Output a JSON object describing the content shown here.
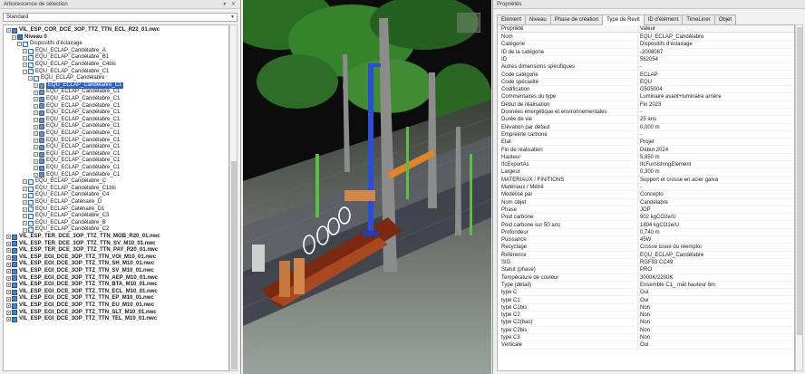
{
  "left_panel": {
    "title": "Arborescence de sélection",
    "controls": "▾ ✕",
    "mode_select": "Standard",
    "tree": [
      {
        "level": 0,
        "expander": "−",
        "icon": "file",
        "label": "VIL_ESP_COR_DCE_3OP_TTZ_TTN_ECL_R22_01.nwc",
        "bold": true
      },
      {
        "level": 1,
        "expander": "−",
        "icon": "layer",
        "label": "Niveau 0",
        "bold": true
      },
      {
        "level": 2,
        "expander": "−",
        "icon": "group",
        "label": "Dispositifs d'éclairage"
      },
      {
        "level": 3,
        "expander": "+",
        "icon": "group",
        "label": "EQU_ECLAP_Candélabre_A"
      },
      {
        "level": 3,
        "expander": "+",
        "icon": "group",
        "label": "EQU_ECLAP_Candélabre_B1"
      },
      {
        "level": 3,
        "expander": "+",
        "icon": "group",
        "label": "EQU_ECLAP_Candélabre_C4bis"
      },
      {
        "level": 3,
        "expander": "−",
        "icon": "group",
        "label": "EQU_ECLAP_Candélabre_C1"
      },
      {
        "level": 4,
        "expander": "−",
        "icon": "group",
        "label": "EQU_ECLAP_Candélabre"
      },
      {
        "level": 5,
        "expander": "+",
        "icon": "obj",
        "label": "EQU_ECLAP_Candélabre_C1",
        "selected": true
      },
      {
        "level": 5,
        "expander": "+",
        "icon": "obj",
        "label": "EQU_ECLAP_Candélabre_C1"
      },
      {
        "level": 5,
        "expander": "+",
        "icon": "obj",
        "label": "EQU_ECLAP_Candélabre_C1"
      },
      {
        "level": 5,
        "expander": "+",
        "icon": "obj",
        "label": "EQU_ECLAP_Candélabre_C1"
      },
      {
        "level": 5,
        "expander": "+",
        "icon": "obj",
        "label": "EQU_ECLAP_Candélabre_C1"
      },
      {
        "level": 5,
        "expander": "+",
        "icon": "obj",
        "label": "EQU_ECLAP_Candélabre_C1"
      },
      {
        "level": 5,
        "expander": "+",
        "icon": "obj",
        "label": "EQU_ECLAP_Candélabre_C1"
      },
      {
        "level": 5,
        "expander": "+",
        "icon": "obj",
        "label": "EQU_ECLAP_Candélabre_C1"
      },
      {
        "level": 5,
        "expander": "+",
        "icon": "obj",
        "label": "EQU_ECLAP_Candélabre_C1"
      },
      {
        "level": 5,
        "expander": "+",
        "icon": "obj",
        "label": "EQU_ECLAP_Candélabre_C1"
      },
      {
        "level": 5,
        "expander": "+",
        "icon": "obj",
        "label": "EQU_ECLAP_Candélabre_C1"
      },
      {
        "level": 5,
        "expander": "+",
        "icon": "obj",
        "label": "EQU_ECLAP_Candélabre_C1"
      },
      {
        "level": 5,
        "expander": "+",
        "icon": "obj",
        "label": "EQU_ECLAP_Candélabre_C1"
      },
      {
        "level": 5,
        "expander": "+",
        "icon": "obj",
        "label": "EQU_ECLAP_Candélabre_C1"
      },
      {
        "level": 3,
        "expander": "+",
        "icon": "group",
        "label": "EQU_ECLAP_Candélabre_C"
      },
      {
        "level": 3,
        "expander": "+",
        "icon": "group",
        "label": "EQU_ECLAP_Candélabre_C1bis"
      },
      {
        "level": 3,
        "expander": "+",
        "icon": "group",
        "label": "EQU_ECLAP_Candélabre_C4"
      },
      {
        "level": 3,
        "expander": "+",
        "icon": "group",
        "label": "EQU_ECLAP_Caténaire_D"
      },
      {
        "level": 3,
        "expander": "+",
        "icon": "group",
        "label": "EQU_ECLAP_Caténaire_D1"
      },
      {
        "level": 3,
        "expander": "+",
        "icon": "group",
        "label": "EQU_ECLAP_Candélabre_C3"
      },
      {
        "level": 3,
        "expander": "+",
        "icon": "group",
        "label": "EQU_ECLAP_Candélabre_B"
      },
      {
        "level": 3,
        "expander": "+",
        "icon": "group",
        "label": "EQU_ECLAP_Candélabre_C2"
      },
      {
        "level": 0,
        "expander": "+",
        "icon": "file",
        "label": "VIL_ESP_TER_DCE_3OP_TTZ_TTN_MOB_R20_01.nwc",
        "bold": true
      },
      {
        "level": 0,
        "expander": "+",
        "icon": "file",
        "label": "VIL_ESP_TER_DCE_3OP_TTZ_TTN_SV_M10_01.nwc",
        "bold": true
      },
      {
        "level": 0,
        "expander": "+",
        "icon": "file",
        "label": "VIL_ESP_TER_DCE_3OP_TTZ_TTN_PAY_R20_01.nwc",
        "bold": true
      },
      {
        "level": 0,
        "expander": "+",
        "icon": "file",
        "label": "VIL_ESP_EGI_DCE_3OP_TTZ_TTN_VOI_M10_01.nwc",
        "bold": true
      },
      {
        "level": 0,
        "expander": "+",
        "icon": "file",
        "label": "VIL_ESP_EGI_DCE_3OP_TTZ_TTN_SH_M10_01.nwc",
        "bold": true
      },
      {
        "level": 0,
        "expander": "+",
        "icon": "file",
        "label": "VIL_ESP_EGI_DCE_3OP_TTZ_TTN_SV_M10_01.nwc",
        "bold": true
      },
      {
        "level": 0,
        "expander": "+",
        "icon": "file",
        "label": "VIL_ESP_EGI_DCE_3OP_TTZ_TTN_AEP_M10_01.nwc",
        "bold": true
      },
      {
        "level": 0,
        "expander": "+",
        "icon": "file",
        "label": "VIL_ESP_EGI_DCE_3OP_TTZ_TTN_BTA_M10_01.nwc",
        "bold": true
      },
      {
        "level": 0,
        "expander": "+",
        "icon": "file",
        "label": "VIL_ESP_EGI_DCE_3OP_TTZ_TTN_ECL_M10_01.nwc",
        "bold": true
      },
      {
        "level": 0,
        "expander": "+",
        "icon": "file",
        "label": "VIL_ESP_EGI_DCE_3OP_TTZ_TTN_EP_M10_01.nwc",
        "bold": true
      },
      {
        "level": 0,
        "expander": "+",
        "icon": "file",
        "label": "VIL_ESP_EGI_DCE_3OP_TTZ_TTN_EU_M10_01.nwc",
        "bold": true
      },
      {
        "level": 0,
        "expander": "+",
        "icon": "file",
        "label": "VIL_ESP_EGI_DCE_3OP_TTZ_TTN_SLT_M10_01.nwc",
        "bold": true
      },
      {
        "level": 0,
        "expander": "+",
        "icon": "file",
        "label": "VIL_ESP_EGI_DCE_3OP_TTZ_TTN_TEL_M10_01.nwc",
        "bold": true
      }
    ]
  },
  "right_panel": {
    "title": "Propriétés",
    "tabs": [
      {
        "label": "Elément",
        "active": false
      },
      {
        "label": "Niveau",
        "active": false
      },
      {
        "label": "Phase de création",
        "active": false
      },
      {
        "label": "Type de Revit",
        "active": true
      },
      {
        "label": "ID d'élément",
        "active": false
      },
      {
        "label": "TimeLiner",
        "active": false
      },
      {
        "label": "Objet",
        "active": false
      }
    ],
    "header": {
      "key": "Propriété",
      "value": "Valeur"
    },
    "rows": [
      {
        "k": "Nom",
        "v": "EQU_ECLAP_Candélabre"
      },
      {
        "k": "Catégorie",
        "v": "Dispositifs d'éclairage"
      },
      {
        "k": "ID de la catégorie",
        "v": "-2008087"
      },
      {
        "k": "ID",
        "v": "562054"
      },
      {
        "k": "Autres dimensions spécifiques",
        "v": "-"
      },
      {
        "k": "Code catégorie",
        "v": "ECLAP"
      },
      {
        "k": "Code spécialité",
        "v": "EQU"
      },
      {
        "k": "Codification",
        "v": "G505004"
      },
      {
        "k": "Commentaires du type",
        "v": "Luminaire avant+luminaire arrière"
      },
      {
        "k": "Début de réalisation",
        "v": "Fin 2023"
      },
      {
        "k": "Données énergétique et environnementales",
        "v": "-"
      },
      {
        "k": "Durée de vie",
        "v": "25 ans"
      },
      {
        "k": "Elévation par défaut",
        "v": "0,000 m"
      },
      {
        "k": "Empreinte carbone",
        "v": "-"
      },
      {
        "k": "Etat",
        "v": "Projet"
      },
      {
        "k": "Fin de réalisation",
        "v": "Début 2024"
      },
      {
        "k": "Hauteur",
        "v": "5,850 m"
      },
      {
        "k": "IfcExportAs",
        "v": "IfcFurnishingElement"
      },
      {
        "k": "Largeur",
        "v": "0,300 m"
      },
      {
        "k": "MATERIAUX / FINITIONS",
        "v": "Support et crosse en acier galva"
      },
      {
        "k": "Matériaux / Métré",
        "v": "-"
      },
      {
        "k": "Modélisé par",
        "v": "Concepto"
      },
      {
        "k": "Nom objet",
        "v": "Candélabre"
      },
      {
        "k": "Phase",
        "v": "JOP"
      },
      {
        "k": "Poid carbone",
        "v": "902 kgCO2e/U"
      },
      {
        "k": "Poid carbone sur 50 ans",
        "v": "1804 kgCO2e/U"
      },
      {
        "k": "Profondeur",
        "v": "0,740 m"
      },
      {
        "k": "Puissance",
        "v": "45W"
      },
      {
        "k": "Recyclage",
        "v": "Crosse issue du réemploi"
      },
      {
        "k": "Référence",
        "v": "EQU_ECLAP_Candélabre"
      },
      {
        "k": "SIG",
        "v": "RGF93 CC49"
      },
      {
        "k": "Statut (phase)",
        "v": "PRO"
      },
      {
        "k": "Température de couleur",
        "v": "3000K/2200K"
      },
      {
        "k": "Type (détail)",
        "v": "Ensemble C1_ mât hauteur 6m"
      },
      {
        "k": "type C",
        "v": "Oui"
      },
      {
        "k": "type C1",
        "v": "Oui"
      },
      {
        "k": "type C1bis",
        "v": "Non"
      },
      {
        "k": "type C2",
        "v": "Non"
      },
      {
        "k": "type C2(bas)",
        "v": "Non"
      },
      {
        "k": "type C2bis",
        "v": "Non"
      },
      {
        "k": "type C3",
        "v": "Non"
      },
      {
        "k": "Verticale",
        "v": "Oui"
      }
    ]
  },
  "colors": {
    "selection": "#2f63c7",
    "panel_bg": "#f0f0f0",
    "viewport_bg": "#0e0e0e"
  }
}
